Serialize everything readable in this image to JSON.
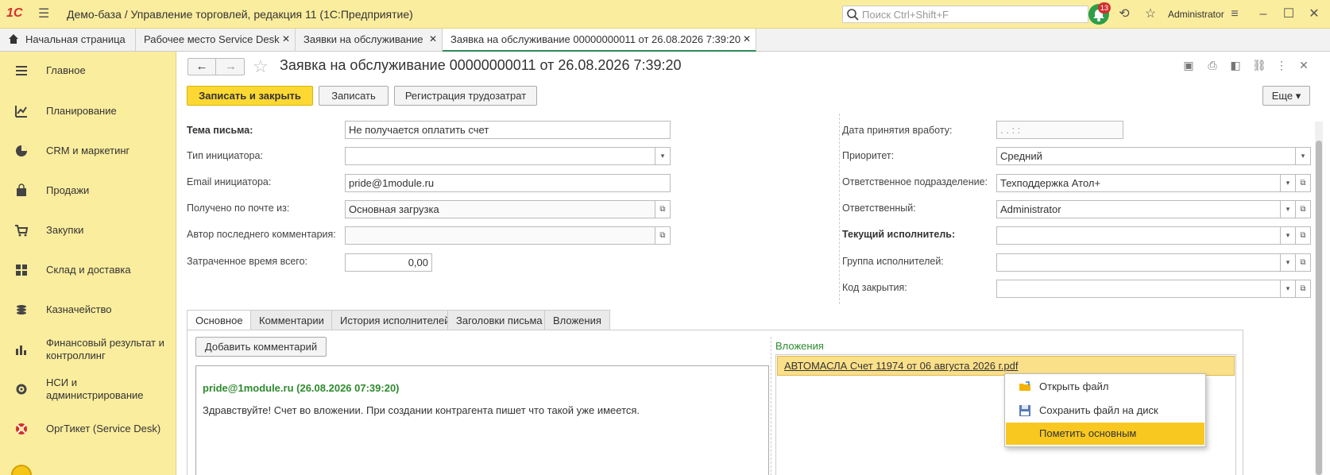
{
  "titlebar": {
    "logo": "1С",
    "title": "Демо-база / Управление торговлей, редакция 11  (1С:Предприятие)",
    "search_placeholder": "Поиск Ctrl+Shift+F",
    "notifications_count": "13",
    "user": "Administrator"
  },
  "tabs": [
    {
      "label": "Начальная страница"
    },
    {
      "label": "Рабочее место Service Desk"
    },
    {
      "label": "Заявки на обслуживание"
    },
    {
      "label": "Заявка на обслуживание 00000000011 от 26.08.2026 7:39:20"
    }
  ],
  "sidebar": {
    "items": [
      {
        "label": "Главное",
        "icon": "menu-icon"
      },
      {
        "label": "Планирование",
        "icon": "chart-icon"
      },
      {
        "label": "CRM и маркетинг",
        "icon": "pie-icon"
      },
      {
        "label": "Продажи",
        "icon": "bag-icon"
      },
      {
        "label": "Закупки",
        "icon": "cart-icon"
      },
      {
        "label": "Склад и доставка",
        "icon": "warehouse-icon"
      },
      {
        "label": "Казначейство",
        "icon": "coins-icon"
      },
      {
        "label": "Финансовый результат и контроллинг",
        "icon": "bars-icon"
      },
      {
        "label": "НСИ и администрирование",
        "icon": "gear-icon"
      },
      {
        "label": "ОргТикет (Service Desk)",
        "icon": "lifebuoy-icon"
      }
    ]
  },
  "document": {
    "title": "Заявка на обслуживание 00000000011 от 26.08.2026 7:39:20",
    "buttons": {
      "save_close": "Записать и закрыть",
      "save": "Записать",
      "register_labor": "Регистрация трудозатрат",
      "more": "Еще"
    },
    "left": {
      "subject_label": "Тема письма:",
      "subject_value": "Не получается оплатить счет",
      "initiator_type_label": "Тип инициатора:",
      "initiator_type_value": "",
      "email_label": "Email инициатора:",
      "email_value": "pride@1module.ru",
      "received_label": "Получено по почте из:",
      "received_value": "Основная загрузка",
      "last_author_label": "Автор последнего комментария:",
      "last_author_value": "",
      "time_label": "Затраченное время всего:",
      "time_value": "0,00"
    },
    "right": {
      "accepted_label": "Дата принятия вработу:",
      "accepted_value": " .  .        :  :",
      "priority_label": "Приоритет:",
      "priority_value": "Средний",
      "dept_label": "Ответственное подразделение:",
      "dept_value": "Техподдержка Атол+",
      "responsible_label": "Ответственный:",
      "responsible_value": "Administrator",
      "executor_label": "Текущий исполнитель:",
      "executor_value": "",
      "group_label": "Группа исполнителей:",
      "group_value": "",
      "close_code_label": "Код закрытия:",
      "close_code_value": ""
    },
    "form_tabs": [
      {
        "label": "Основное"
      },
      {
        "label": "Комментарии"
      },
      {
        "label": "История исполнителей"
      },
      {
        "label": "Заголовки письма"
      },
      {
        "label": "Вложения"
      }
    ],
    "add_comment": "Добавить комментарий",
    "comment": {
      "author": "pride@1module.ru (26.08.2026 07:39:20)",
      "text": "Здравствуйте! Счет во вложении. При создании контрагента пишет что такой уже имеется."
    },
    "attachments_label": "Вложения",
    "attachment_file": "АВТОМАСЛА Счет 11974 от 06 августа 2026 г.pdf",
    "context_menu": [
      {
        "label": "Открыть файл"
      },
      {
        "label": "Сохранить файл на диск"
      },
      {
        "label": "Пометить основным"
      }
    ]
  }
}
